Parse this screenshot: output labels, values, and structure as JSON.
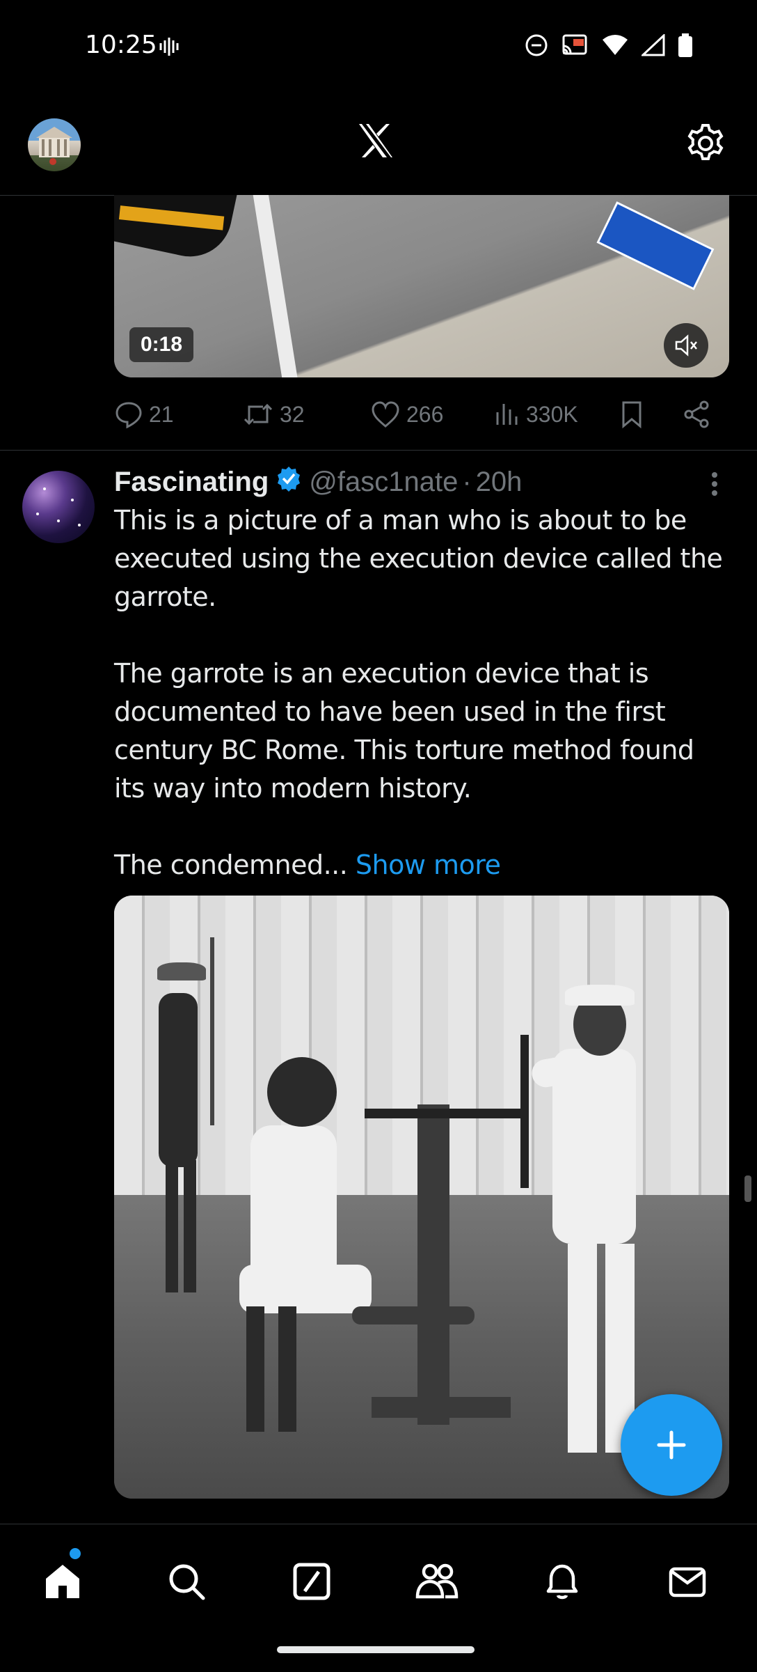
{
  "status_bar": {
    "time": "10:25",
    "icons": [
      "vibrate-icon",
      "do-not-disturb-icon",
      "cast-icon",
      "wifi-icon",
      "signal-icon",
      "battery-icon"
    ]
  },
  "header": {
    "logo": "X",
    "icons": [
      "profile-avatar",
      "x-logo-icon",
      "settings-gear-icon"
    ]
  },
  "previous_post": {
    "video": {
      "duration": "0:18",
      "muted": true
    },
    "actions": {
      "replies": "21",
      "reposts": "32",
      "likes": "266",
      "views": "330K"
    }
  },
  "post": {
    "author_name": "Fascinating",
    "verified": true,
    "handle": "@fasc1nate",
    "separator": "·",
    "time_ago": "20h",
    "paragraph1": "This is a picture of a man who is about to be executed using the execution device called the garrote.",
    "paragraph2": "The garrote is an execution device that is documented to have been used in the first century BC Rome. This torture method found its way into modern history.",
    "paragraph3": "The condemned...",
    "show_more": "Show more"
  },
  "bottom_nav": {
    "items": [
      "home-icon",
      "search-icon",
      "grok-icon",
      "communities-icon",
      "notifications-icon",
      "messages-icon"
    ],
    "home_has_badge": true
  },
  "colors": {
    "accent": "#1d9bf0",
    "background": "#000000",
    "muted_text": "#71767b",
    "text": "#e7e9ea"
  }
}
